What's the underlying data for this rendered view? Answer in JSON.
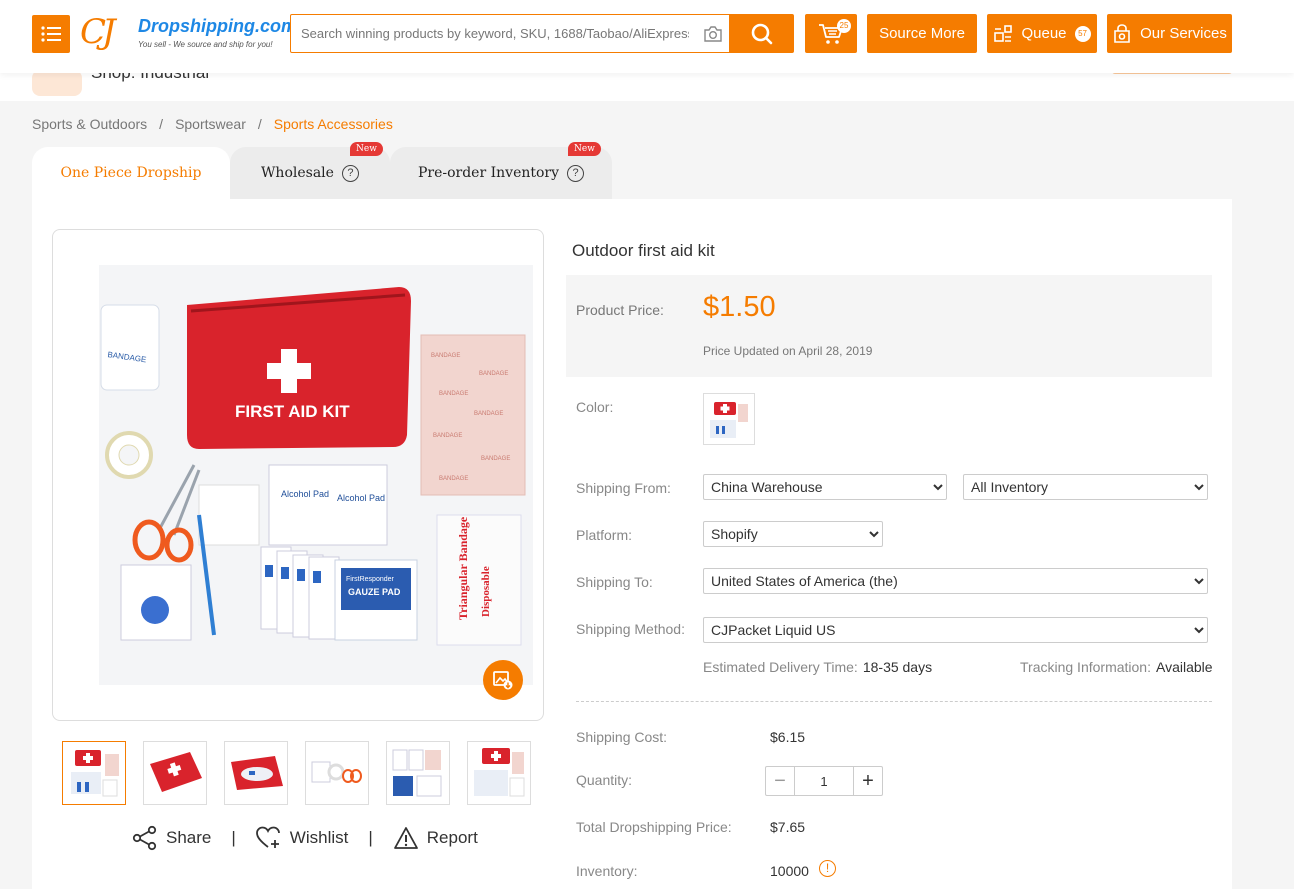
{
  "header": {
    "logo_cj": "CJ",
    "logo_name": "Dropshipping.com",
    "logo_tagline": "You sell - We source and ship for you!",
    "search_placeholder": "Search winning products by keyword, SKU, 1688/Taobao/AliExpress URL",
    "cart_count": "25",
    "source_more": "Source More",
    "queue": "Queue",
    "queue_count": "57",
    "our_services": "Our Services",
    "accent": "#f57c00"
  },
  "store": {
    "name": "Shop: Industrial"
  },
  "breadcrumb": [
    "Sports & Outdoors",
    "Sportswear",
    "Sports Accessories"
  ],
  "tabs": [
    {
      "label": "One Piece Dropship",
      "active": true
    },
    {
      "label": "Wholesale",
      "badge": "New"
    },
    {
      "label": "Pre-order Inventory",
      "badge": "New"
    }
  ],
  "gallery": {
    "main_image": "first-aid-kit-photo",
    "thumbnails": [
      "kit-contents",
      "red-pouch-closed",
      "red-pouch-open",
      "scissors-and-tape",
      "bandage-packs",
      "kit-contents-alt"
    ]
  },
  "actions": {
    "share": "Share",
    "wishlist": "Wishlist",
    "report": "Report"
  },
  "product": {
    "title": "Outdoor first aid kit",
    "price_label": "Product Price:",
    "price": "$1.50",
    "price_updated": "Price Updated on April 28, 2019",
    "color_label": "Color:",
    "shipping_from_label": "Shipping From:",
    "shipping_from": "China Warehouse",
    "inventory_filter": "All Inventory",
    "platform_label": "Platform:",
    "platform": "Shopify",
    "shipping_to_label": "Shipping To:",
    "shipping_to": "United States of America (the)",
    "shipping_method_label": "Shipping Method:",
    "shipping_method": "CJPacket Liquid US",
    "est_delivery_label": "Estimated Delivery Time:",
    "est_delivery": "18-35 days",
    "tracking_label": "Tracking Information:",
    "tracking": "Available",
    "shipping_cost_label": "Shipping Cost:",
    "shipping_cost": "$6.15",
    "quantity_label": "Quantity:",
    "quantity": "1",
    "total_label": "Total Dropshipping Price:",
    "total": "$7.65",
    "inventory_label": "Inventory:",
    "inventory": "10000"
  }
}
